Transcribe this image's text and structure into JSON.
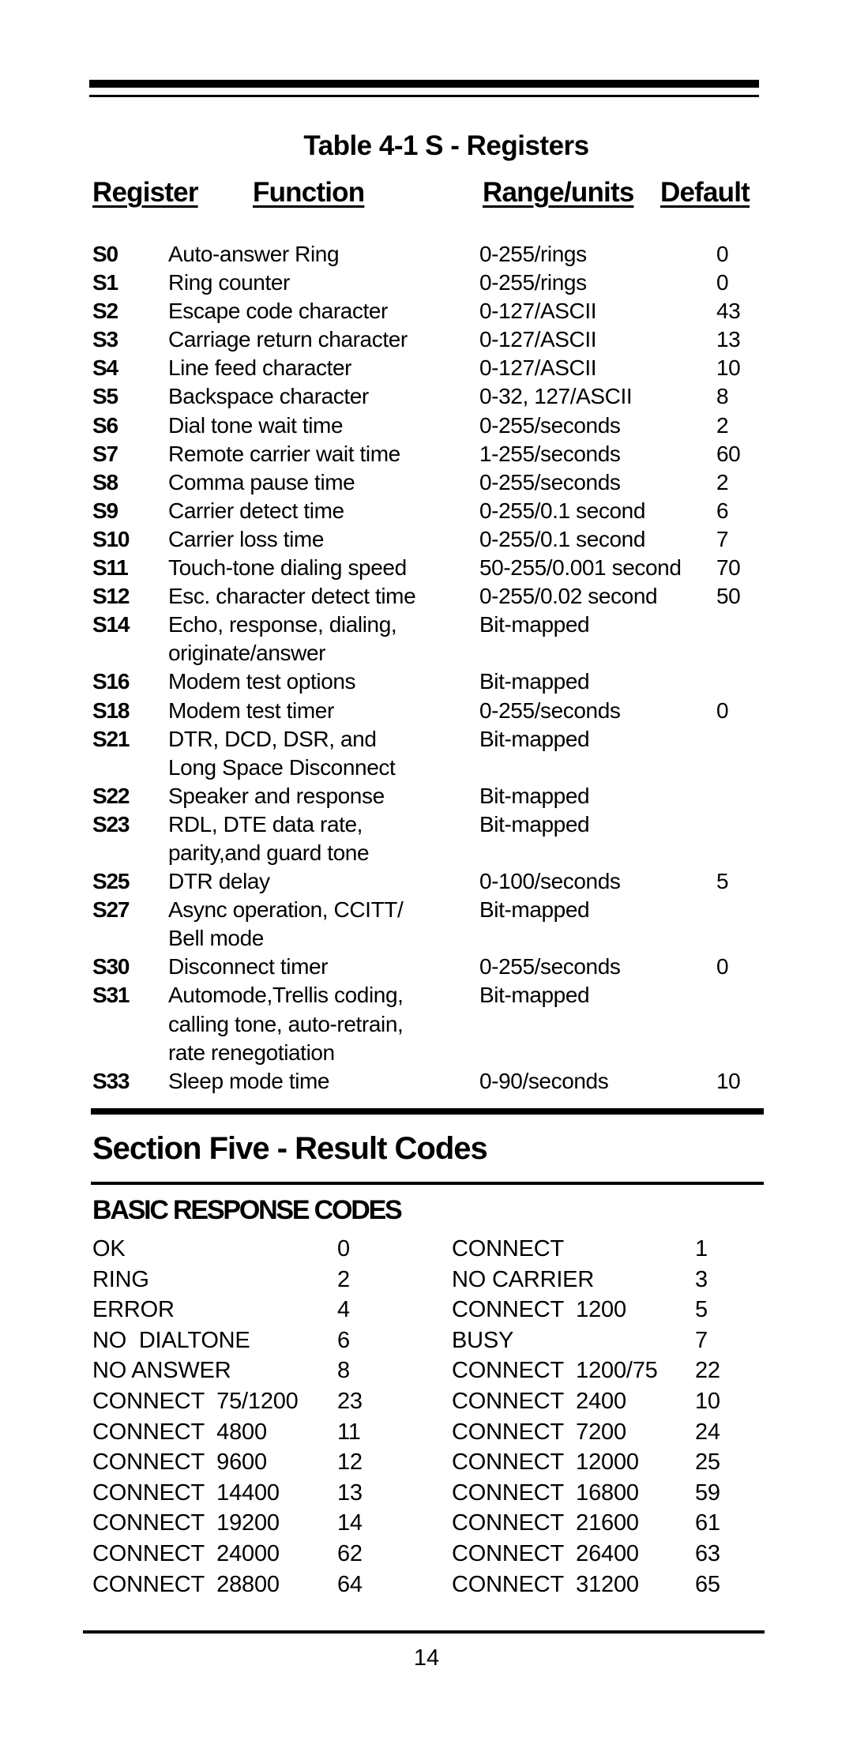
{
  "table": {
    "title": "Table 4-1 S - Registers",
    "headers": {
      "register": "Register",
      "function": "Function",
      "range": "Range/units",
      "default": "Default"
    },
    "rows": [
      {
        "register": "S0",
        "function": [
          "Auto-answer Ring"
        ],
        "range": "0-255/rings",
        "default": "0"
      },
      {
        "register": "S1",
        "function": [
          "Ring counter"
        ],
        "range": "0-255/rings",
        "default": "0"
      },
      {
        "register": "S2",
        "function": [
          "Escape code character"
        ],
        "range": "0-127/ASCII",
        "default": "43"
      },
      {
        "register": "S3",
        "function": [
          "Carriage return character"
        ],
        "range": "0-127/ASCII",
        "default": "13"
      },
      {
        "register": "S4",
        "function": [
          "Line feed character"
        ],
        "range": "0-127/ASCII",
        "default": "10"
      },
      {
        "register": "S5",
        "function": [
          "Backspace character"
        ],
        "range": "0-32, 127/ASCII",
        "default": "8"
      },
      {
        "register": "S6",
        "function": [
          "Dial tone wait time"
        ],
        "range": "0-255/seconds",
        "default": "2"
      },
      {
        "register": "S7",
        "function": [
          "Remote carrier wait time"
        ],
        "range": "1-255/seconds",
        "default": "60"
      },
      {
        "register": "S8",
        "function": [
          "Comma pause time"
        ],
        "range": "0-255/seconds",
        "default": "2"
      },
      {
        "register": "S9",
        "function": [
          "Carrier detect time"
        ],
        "range": "0-255/0.1 second",
        "default": "6"
      },
      {
        "register": "S10",
        "function": [
          "Carrier loss time"
        ],
        "range": "0-255/0.1 second",
        "default": "7"
      },
      {
        "register": "S11",
        "function": [
          "Touch-tone dialing speed"
        ],
        "range": "50-255/0.001 second",
        "default": "70"
      },
      {
        "register": "S12",
        "function": [
          "Esc. character detect time"
        ],
        "range": "0-255/0.02 second",
        "default": "50"
      },
      {
        "register": "S14",
        "function": [
          "Echo, response, dialing,",
          "originate/answer"
        ],
        "range": "Bit-mapped",
        "default": ""
      },
      {
        "register": "S16",
        "function": [
          "Modem test options"
        ],
        "range": "Bit-mapped",
        "default": ""
      },
      {
        "register": "S18",
        "function": [
          "Modem test timer"
        ],
        "range": "0-255/seconds",
        "default": "0"
      },
      {
        "register": "S21",
        "function": [
          "DTR, DCD, DSR, and",
          "Long Space Disconnect"
        ],
        "range": "Bit-mapped",
        "default": ""
      },
      {
        "register": "S22",
        "function": [
          "Speaker and response"
        ],
        "range": "Bit-mapped",
        "default": ""
      },
      {
        "register": "S23",
        "function": [
          "RDL, DTE data rate,",
          "parity,and guard tone"
        ],
        "range": "Bit-mapped",
        "default": ""
      },
      {
        "register": "S25",
        "function": [
          "DTR delay"
        ],
        "range": "0-100/seconds",
        "default": "5"
      },
      {
        "register": "S27",
        "function": [
          "Async operation, CCITT/",
          "Bell mode"
        ],
        "range": "Bit-mapped",
        "default": ""
      },
      {
        "register": "S30",
        "function": [
          "Disconnect timer"
        ],
        "range": "0-255/seconds",
        "default": "0"
      },
      {
        "register": "S31",
        "function": [
          "Automode,Trellis coding,",
          "calling tone, auto-retrain,",
          "rate renegotiation"
        ],
        "range": "Bit-mapped",
        "default": ""
      },
      {
        "register": "S33",
        "function": [
          "Sleep mode time"
        ],
        "range": "0-90/seconds",
        "default": "10"
      }
    ]
  },
  "section": {
    "title": "Section Five - Result Codes",
    "subtitle": "BASIC RESPONSE CODES",
    "codes": [
      [
        {
          "name": "OK",
          "code": "0"
        },
        {
          "name": "CONNECT",
          "code": "1"
        }
      ],
      [
        {
          "name": "RING",
          "code": "2"
        },
        {
          "name": "NO CARRIER",
          "code": "3"
        }
      ],
      [
        {
          "name": "ERROR",
          "code": "4"
        },
        {
          "name": "CONNECT  1200",
          "code": "5"
        }
      ],
      [
        {
          "name": "NO  DIALTONE",
          "code": "6"
        },
        {
          "name": "BUSY",
          "code": "7"
        }
      ],
      [
        {
          "name": "NO ANSWER",
          "code": "8"
        },
        {
          "name": "CONNECT  1200/75",
          "code": "22"
        }
      ],
      [
        {
          "name": "CONNECT  75/1200",
          "code": "23"
        },
        {
          "name": "CONNECT  2400",
          "code": "10"
        }
      ],
      [
        {
          "name": "CONNECT  4800",
          "code": "11"
        },
        {
          "name": "CONNECT  7200",
          "code": "24"
        }
      ],
      [
        {
          "name": "CONNECT  9600",
          "code": "12"
        },
        {
          "name": "CONNECT  12000",
          "code": "25"
        }
      ],
      [
        {
          "name": "CONNECT  14400",
          "code": "13"
        },
        {
          "name": "CONNECT  16800",
          "code": "59"
        }
      ],
      [
        {
          "name": "CONNECT  19200",
          "code": "14"
        },
        {
          "name": "CONNECT  21600",
          "code": "61"
        }
      ],
      [
        {
          "name": "CONNECT  24000",
          "code": "62"
        },
        {
          "name": "CONNECT  26400",
          "code": "63"
        }
      ],
      [
        {
          "name": "CONNECT  28800",
          "code": "64"
        },
        {
          "name": "CONNECT  31200",
          "code": "65"
        }
      ]
    ]
  },
  "page_number": "14"
}
